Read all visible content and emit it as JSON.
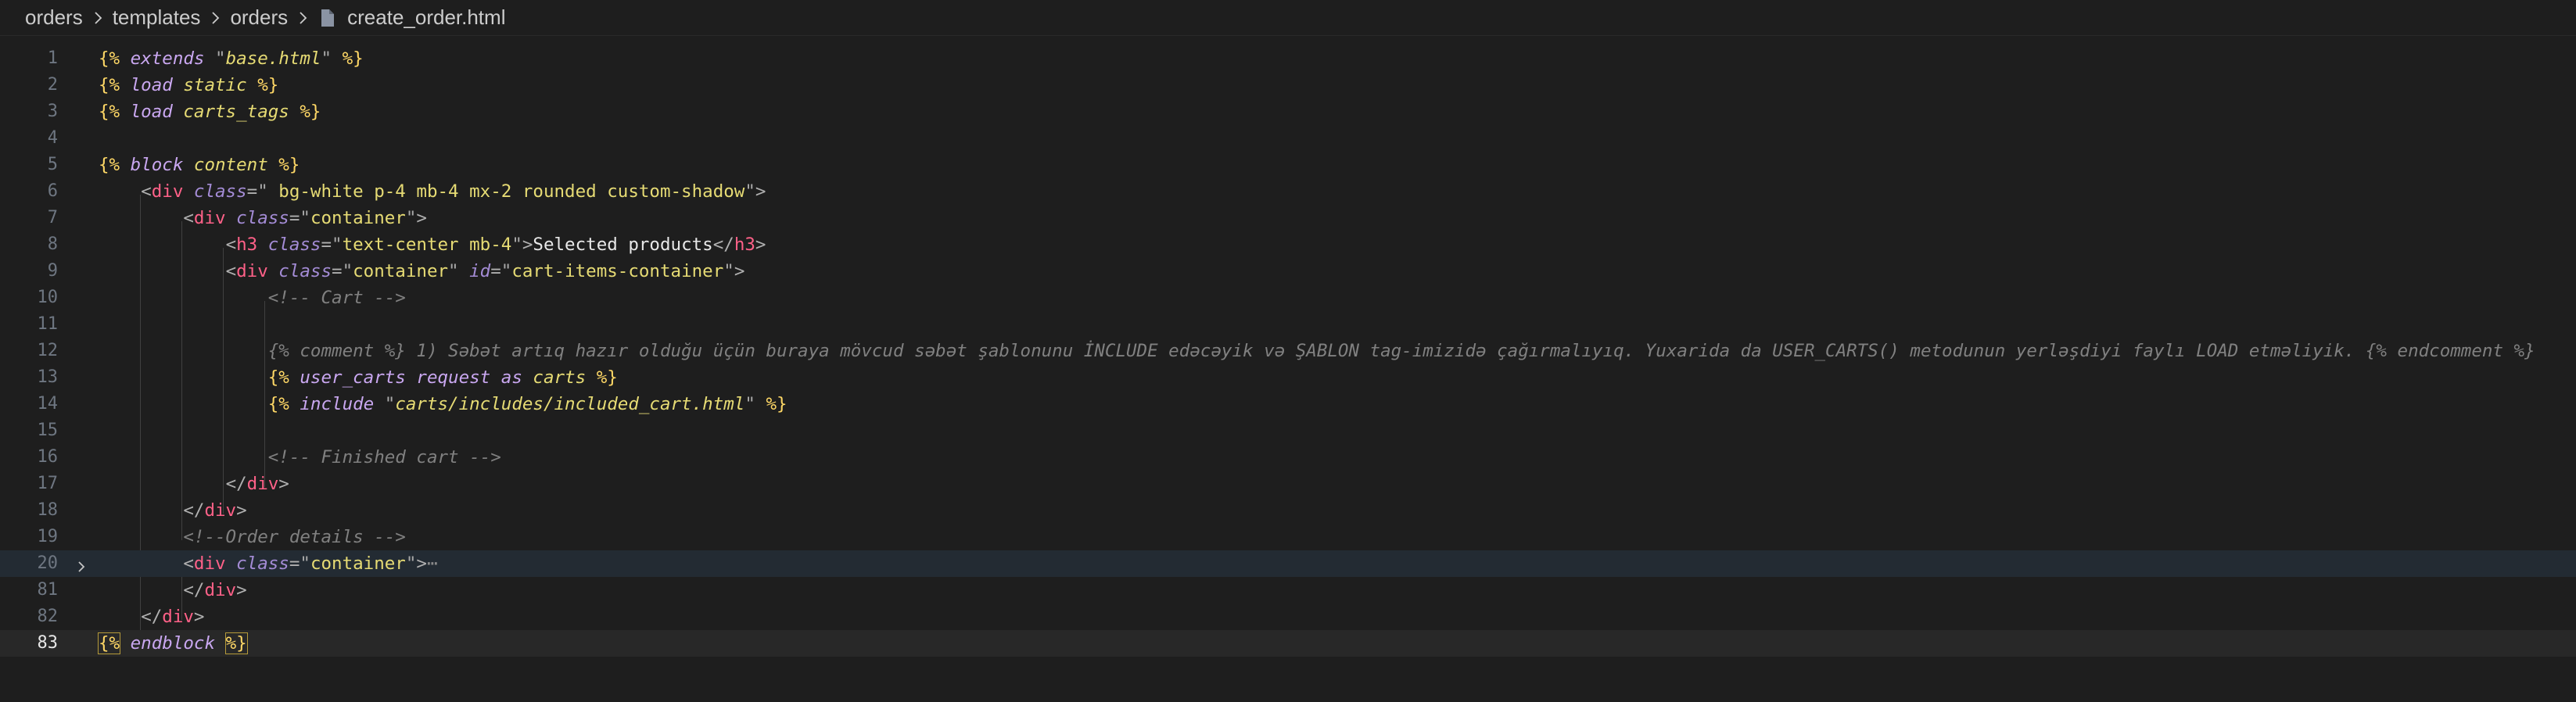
{
  "breadcrumb": {
    "items": [
      "orders",
      "templates",
      "orders"
    ],
    "file": "create_order.html",
    "separator_icon": "chevron-right-icon",
    "file_icon": "file-icon"
  },
  "editor": {
    "active_line": "83",
    "folded_line": "20",
    "lines": [
      {
        "num": "1",
        "text": "{% extends \"base.html\" %}"
      },
      {
        "num": "2",
        "text": "{% load static %}"
      },
      {
        "num": "3",
        "text": "{% load carts_tags %}"
      },
      {
        "num": "4",
        "text": ""
      },
      {
        "num": "5",
        "text": "{% block content %}"
      },
      {
        "num": "6",
        "text": "    <div class=\" bg-white p-4 mb-4 mx-2 rounded custom-shadow\">"
      },
      {
        "num": "7",
        "text": "        <div class=\"container\">"
      },
      {
        "num": "8",
        "text": "            <h3 class=\"text-center mb-4\">Selected products</h3>"
      },
      {
        "num": "9",
        "text": "            <div class=\"container\" id=\"cart-items-container\">"
      },
      {
        "num": "10",
        "text": "                <!-- Cart -->"
      },
      {
        "num": "11",
        "text": ""
      },
      {
        "num": "12",
        "text": "                {% comment %} 1) Səbət artıq hazır olduğu üçün buraya mövcud səbət şablonunu İNCLUDE edəcəyik və ŞABLON tag-imizidə çağırmalıyıq. Yuxarida da USER_CARTS() metodunun yerləşdiyi faylı LOAD etməliyik. {% endcomment %}"
      },
      {
        "num": "13",
        "text": "                {% user_carts request as carts %}"
      },
      {
        "num": "14",
        "text": "                {% include \"carts/includes/included_cart.html\" %}"
      },
      {
        "num": "15",
        "text": ""
      },
      {
        "num": "16",
        "text": "                <!-- Finished cart -->"
      },
      {
        "num": "17",
        "text": "            </div>"
      },
      {
        "num": "18",
        "text": "        </div>"
      },
      {
        "num": "19",
        "text": "        <!--Order details -->"
      },
      {
        "num": "20",
        "text": "        <div class=\"container\">⋯"
      },
      {
        "num": "81",
        "text": "        </div>"
      },
      {
        "num": "82",
        "text": "    </div>"
      },
      {
        "num": "83",
        "text": "{% endblock %}"
      }
    ]
  },
  "colors": {
    "background": "#1e1e1e",
    "template_tag": "#ffd866",
    "keyword": "#c9a7f0",
    "html_tag": "#ff6188",
    "string": "#e6db74",
    "comment": "#808080",
    "line_number": "#6e7681"
  }
}
